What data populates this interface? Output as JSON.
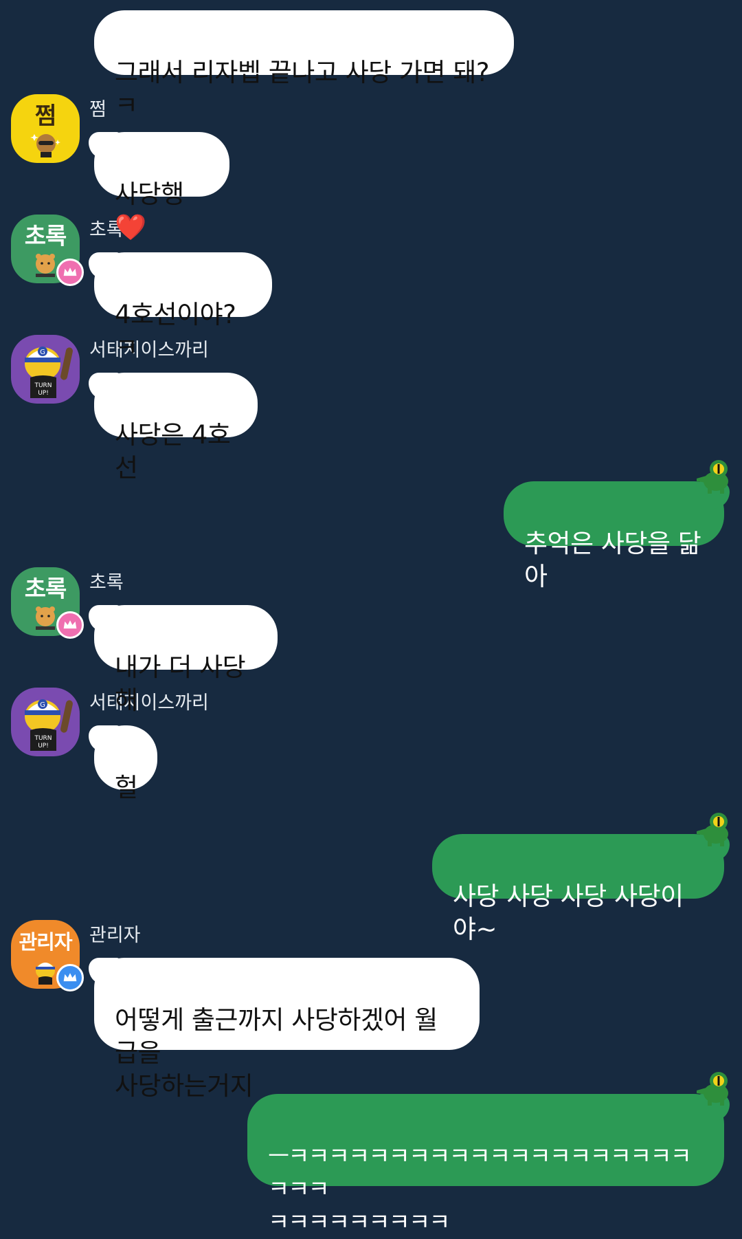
{
  "messages": [
    {
      "sender": "",
      "text": "그래서 리자벱 끝나고 사당 가면 돼? ㅋ"
    },
    {
      "sender": "쩜",
      "avatar_text": "쩜",
      "text": "사당행❤️"
    },
    {
      "sender": "초록",
      "avatar_text": "초록",
      "text": "4호선이야? ㅋ"
    },
    {
      "sender": "서태지이스까리",
      "avatar_text": "",
      "text": "사당은 4호선"
    },
    {
      "sender": "",
      "text": "추억은 사당을 닮아"
    },
    {
      "sender": "초록",
      "avatar_text": "초록",
      "text": "내가 더 사당해"
    },
    {
      "sender": "서태지이스까리",
      "avatar_text": "",
      "text": "헐"
    },
    {
      "sender": "",
      "text": "사당 사당 사당 사당이야~"
    },
    {
      "sender": "관리자",
      "avatar_text": "관리자",
      "text": "어떻게 출근까지 사당하겠어 월급을\n사당하는거지"
    },
    {
      "sender": "",
      "text": "ㅡㅋㅋㅋㅋㅋㅋㅋㅋㅋㅋㅋㅋㅋㅋㅋㅋㅋㅋㅋㅋㅋㅋㅋ\nㅋㅋㅋㅋㅋㅋㅋㅋㅋ"
    }
  ],
  "avatar_icons": {
    "jjeom": "muzi-tube-yellow-icon",
    "chorok": "ryan-crown-green-icon",
    "seotaeji": "cap-character-purple-icon",
    "admin": "admin-crown-orange-icon",
    "me": "green-crocodile-icon"
  },
  "colors": {
    "background": "#172a40",
    "incoming_bubble": "#ffffff",
    "outgoing_bubble": "#2c9a55",
    "avatar_yellow": "#f5d40f",
    "avatar_green": "#3d9a62",
    "avatar_purple": "#7a4bb0",
    "avatar_orange": "#f08a2a"
  }
}
